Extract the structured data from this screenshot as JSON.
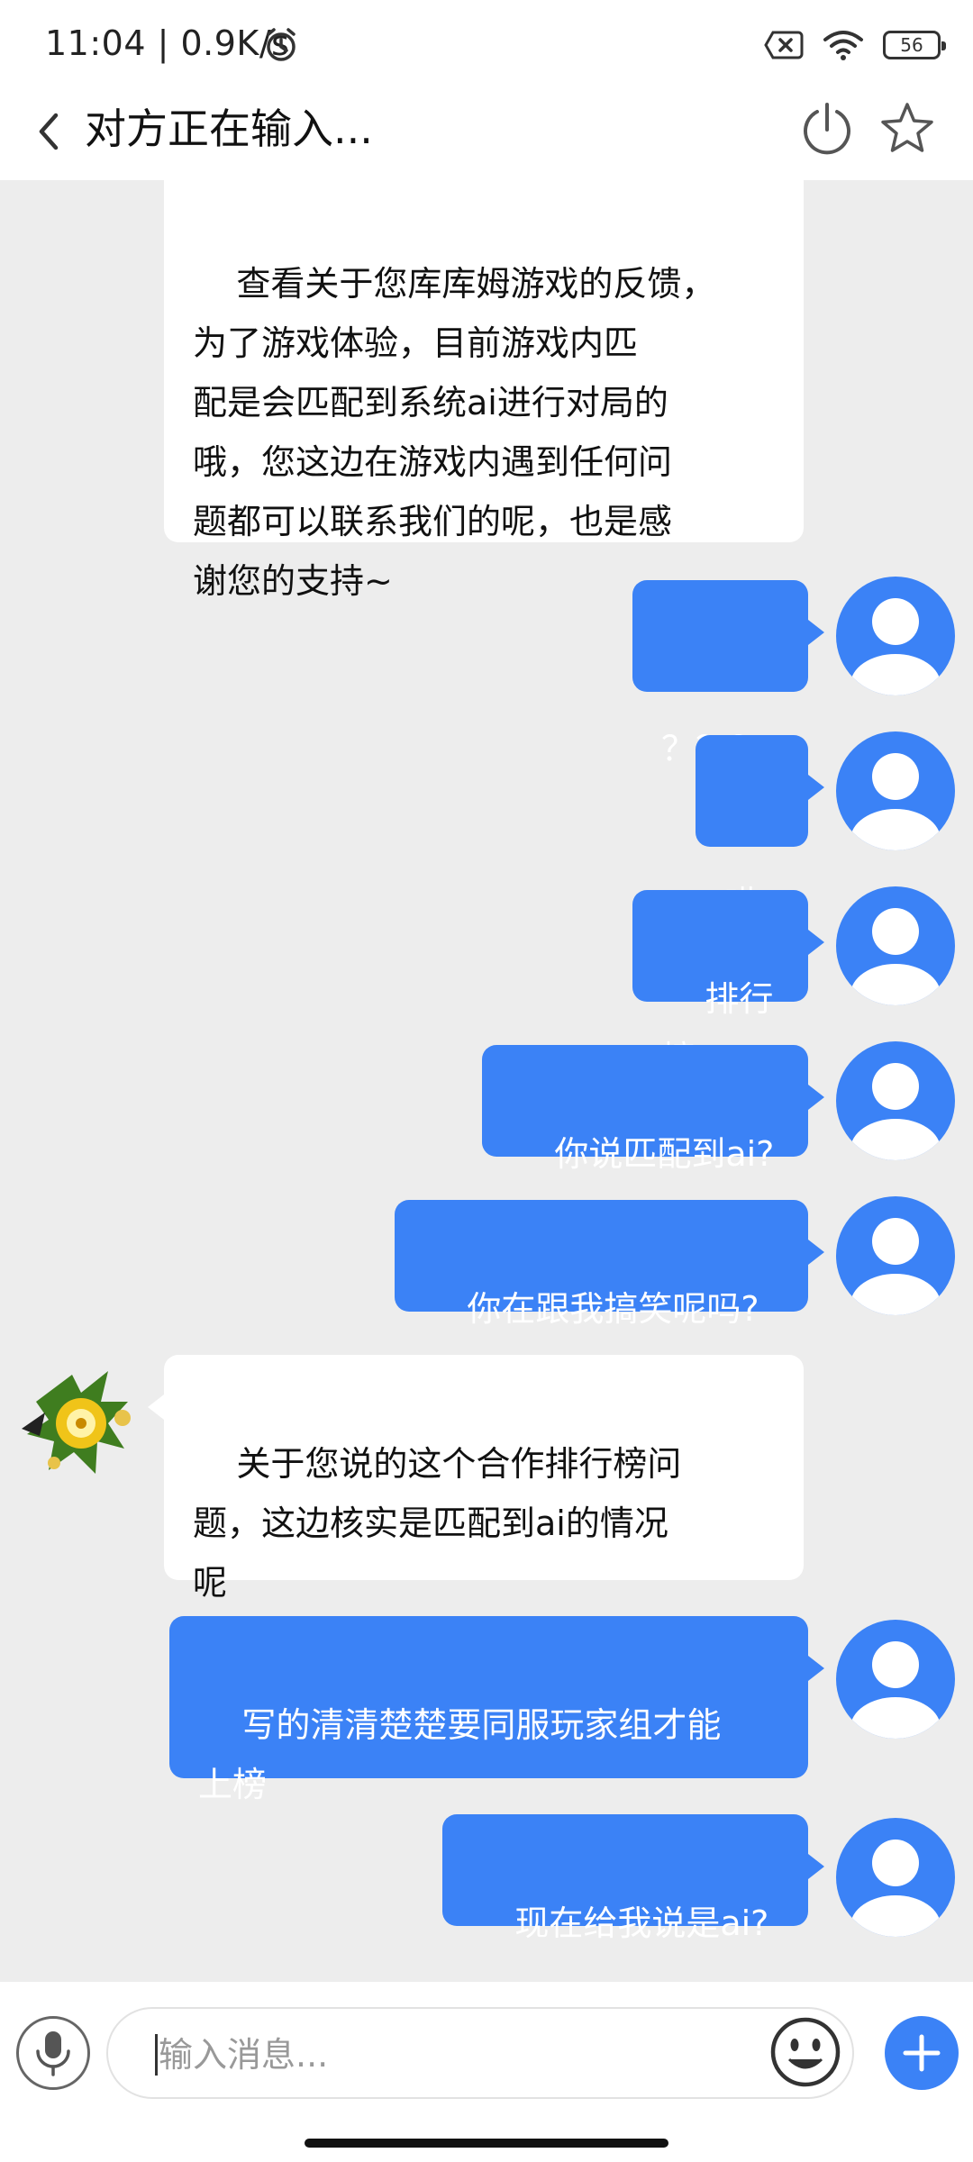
{
  "status_bar": {
    "time": "11:04 | 0.9K/s",
    "battery": "56"
  },
  "header": {
    "title": "对方正在输入..."
  },
  "messages": [
    {
      "side": "in",
      "text": "查看关于您库库姆游戏的反馈，\n为了游戏体验，目前游戏内匹\n配是会匹配到系统ai进行对局的\n哦，您这边在游戏内遇到任何问\n题都可以联系我们的呢，也是感\n谢您的支持~"
    },
    {
      "side": "out",
      "text": "？？？"
    },
    {
      "side": "out",
      "text": "哎"
    },
    {
      "side": "out",
      "text": "排行榜"
    },
    {
      "side": "out",
      "text": "你说匹配到ai?"
    },
    {
      "side": "out",
      "text": "你在跟我搞笑呢吗?"
    },
    {
      "side": "in",
      "text": "关于您说的这个合作排行榜问\n题，这边核实是匹配到ai的情况\n呢"
    },
    {
      "side": "out",
      "text": "写的清清楚楚要同服玩家组才能\n上榜"
    },
    {
      "side": "out",
      "text": "现在给我说是ai?"
    }
  ],
  "input": {
    "placeholder": "输入消息..."
  },
  "colors": {
    "accent": "#3b82f6",
    "background": "#ededed",
    "incoming_bubble": "#ffffff"
  },
  "icons": [
    "back-icon",
    "power-icon",
    "star-icon",
    "microphone-icon",
    "emoji-icon",
    "plus-icon",
    "alarm-icon",
    "wifi-icon",
    "sim-icon"
  ]
}
